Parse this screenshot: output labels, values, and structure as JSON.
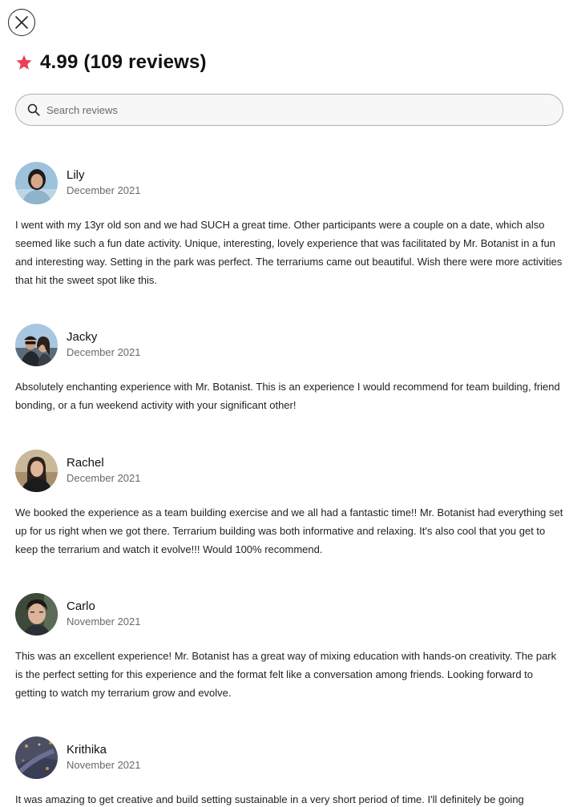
{
  "header": {
    "close_label": "Close",
    "rating": "4.99",
    "reviews_count": "(109 reviews)",
    "rating_text": "4.99 (109 reviews)",
    "star_color": "#E8415A"
  },
  "search": {
    "placeholder": "Search reviews",
    "value": ""
  },
  "reviews": [
    {
      "name": "Lily",
      "date": "December 2021",
      "text": "I went with my 13yr old son and we had SUCH a great time. Other participants were a couple on a date, which also seemed like such a fun date activity. Unique, interesting, lovely experience that was facilitated by Mr. Botanist in a fun and interesting way. Setting in the park was perfect. The terrariums came out beautiful. Wish there were more activities that hit the sweet spot like this."
    },
    {
      "name": "Jacky",
      "date": "December 2021",
      "text": "Absolutely enchanting experience with Mr. Botanist. This is an experience I would recommend for team building, friend bonding, or a fun weekend activity with your significant other!"
    },
    {
      "name": "Rachel",
      "date": "December 2021",
      "text": "We booked the experience as a team building exercise and we all had a fantastic time!! Mr. Botanist had everything set up for us right when we got there. Terrarium building was both informative and relaxing. It's also cool that you get to keep the terrarium and watch it evolve!!! Would 100% recommend."
    },
    {
      "name": "Carlo",
      "date": "November 2021",
      "text": "This was an excellent experience! Mr. Botanist has a great way of mixing education with hands-on creativity. The park is the perfect setting for this experience and the format felt like a conversation among friends. Looking forward to getting to watch my terrarium grow and evolve."
    },
    {
      "name": "Krithika",
      "date": "November 2021",
      "text": "It was amazing to get creative and build setting sustainable in a very short period of time. I'll definitely be going"
    }
  ]
}
